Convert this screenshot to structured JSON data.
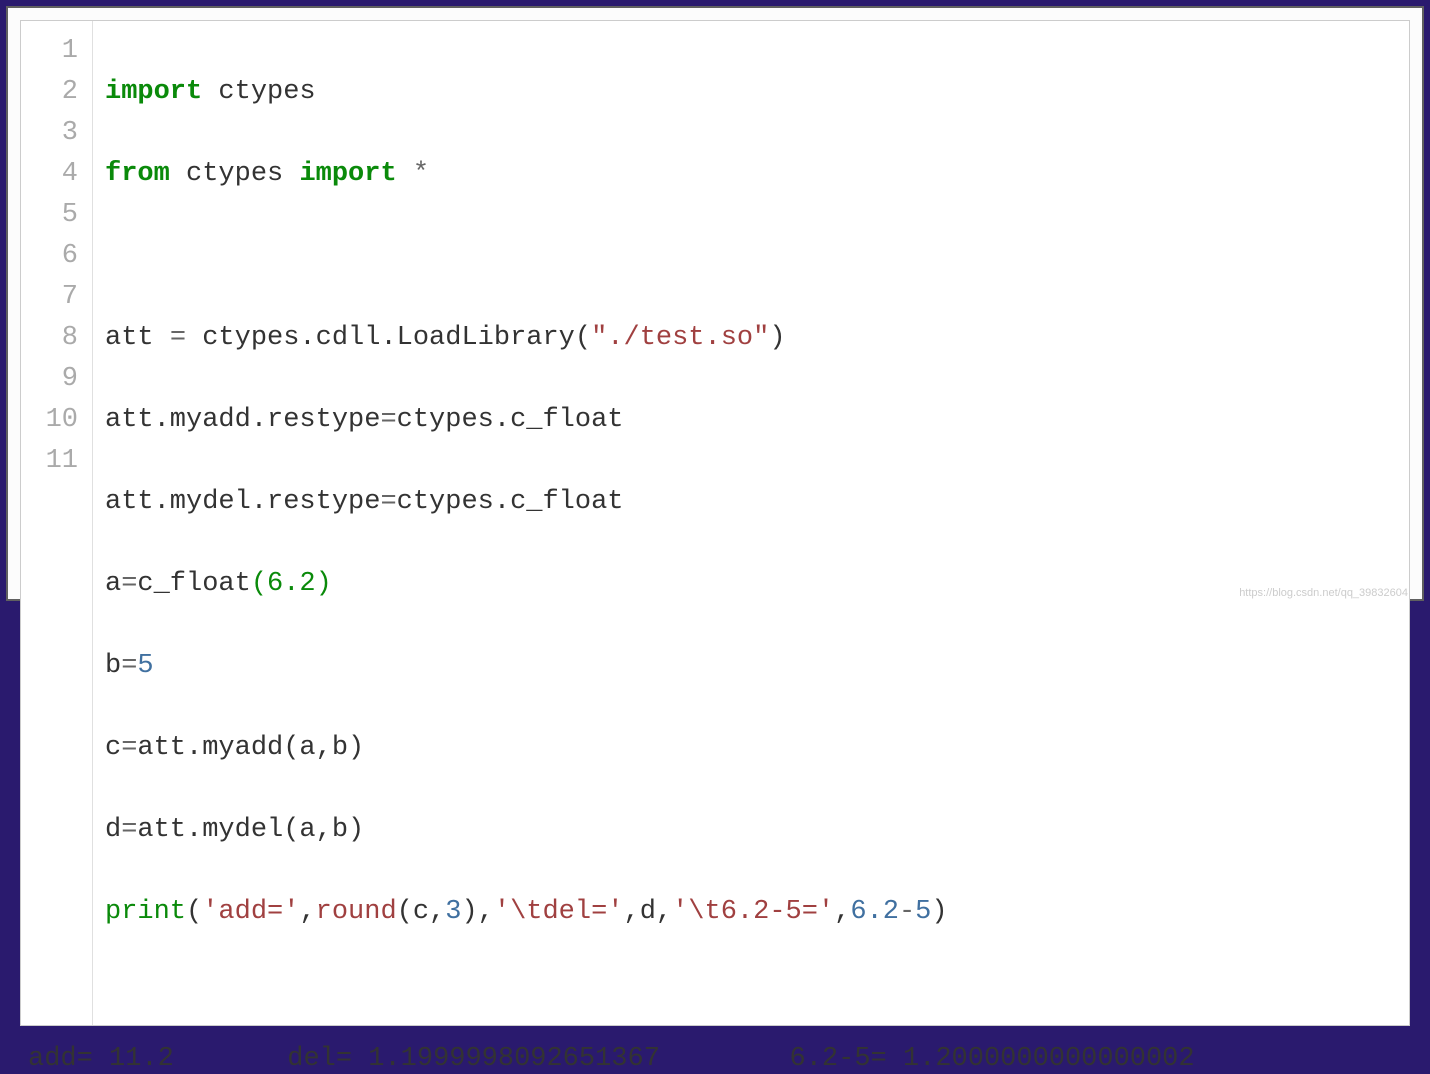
{
  "code": {
    "lines": [
      "1",
      "2",
      "3",
      "4",
      "5",
      "6",
      "7",
      "8",
      "9",
      "10",
      "11"
    ],
    "l1_kw1": "import",
    "l1_rest": " ctypes",
    "l2_kw1": "from",
    "l2_mid": " ctypes ",
    "l2_kw2": "import",
    "l2_star": " *",
    "l4_a": "att ",
    "l4_eq": "=",
    "l4_b": " ctypes.cdll.LoadLibrary(",
    "l4_str": "\"./test.so\"",
    "l4_c": ")",
    "l5": "att.myadd.restype",
    "l5_eq": "=",
    "l5_b": "ctypes.c_float",
    "l6": "att.mydel.restype",
    "l6_eq": "=",
    "l6_b": "ctypes.c_float",
    "l7_a": "a",
    "l7_eq": "=",
    "l7_b": "c_float",
    "l7_po": "(",
    "l7_num": "6.2",
    "l7_pc": ")",
    "l8_a": "b",
    "l8_eq": "=",
    "l8_num": "5",
    "l9_a": "c",
    "l9_eq": "=",
    "l9_b": "att.myadd(a,b)",
    "l10_a": "d",
    "l10_eq": "=",
    "l10_b": "att.mydel(a,b)",
    "l11_print": "print",
    "l11_o": "(",
    "l11_s1": "'add='",
    "l11_c1": ",",
    "l11_round": "round",
    "l11_ra": "(c,",
    "l11_rn": "3",
    "l11_rb": "),",
    "l11_s2": "'\\tdel='",
    "l11_c2": ",d,",
    "l11_s3": "'\\t6.2-5='",
    "l11_c3": ",",
    "l11_n1": "6.2",
    "l11_dash": "-",
    "l11_n2": "5",
    "l11_cl": ")"
  },
  "output": "add= 11.2       del= 1.1999998092651367        6.2-5= 1.2000000000000002",
  "watermark": "https://blog.csdn.net/qq_39832604"
}
